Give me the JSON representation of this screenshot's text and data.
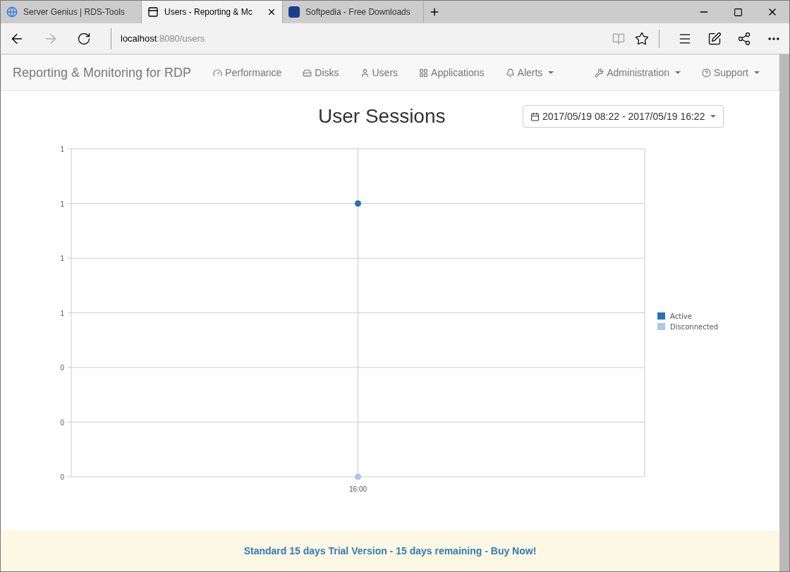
{
  "browser": {
    "tabs": [
      {
        "title": "Server Genius | RDS-Tools",
        "selected": false,
        "closable": false
      },
      {
        "title": "Users - Reporting & Mc",
        "selected": true,
        "closable": true
      },
      {
        "title": "Softpedia - Free Downloads",
        "selected": false,
        "closable": false
      }
    ],
    "address": {
      "host": "localhost",
      "path": ":8080/users"
    }
  },
  "navbar": {
    "brand": "Reporting & Monitoring for RDP",
    "items": [
      {
        "label": "Performance",
        "dropdown": false
      },
      {
        "label": "Disks",
        "dropdown": false
      },
      {
        "label": "Users",
        "dropdown": false
      },
      {
        "label": "Applications",
        "dropdown": false
      },
      {
        "label": "Alerts",
        "dropdown": true
      }
    ],
    "right_items": [
      {
        "label": "Administration",
        "dropdown": true
      },
      {
        "label": "Support",
        "dropdown": true
      }
    ]
  },
  "page": {
    "title": "User Sessions",
    "date_range": "2017/05/19 08:22 - 2017/05/19 16:22",
    "chart_data": {
      "type": "line",
      "grid": true,
      "legend": true,
      "categories": [
        "16:00"
      ],
      "series": [
        {
          "name": "Active",
          "color": "#1f77b4",
          "marker": true,
          "values": [
            1
          ]
        },
        {
          "name": "Disconnected",
          "color": "#aec7e8",
          "marker": true,
          "values": [
            0
          ]
        }
      ],
      "ylim": [
        0,
        1.2
      ],
      "yticks": [
        {
          "value": 1.2,
          "label": "1"
        },
        {
          "value": 1,
          "label": "1"
        },
        {
          "value": 0.8,
          "label": "1"
        },
        {
          "value": 0.6,
          "label": "1"
        },
        {
          "value": 0.4,
          "label": "0"
        },
        {
          "value": 0.2,
          "label": "0"
        },
        {
          "value": 0,
          "label": "0"
        }
      ]
    }
  },
  "footer": {
    "text": "Standard 15 days Trial Version - 15 days remaining - Buy Now!"
  }
}
